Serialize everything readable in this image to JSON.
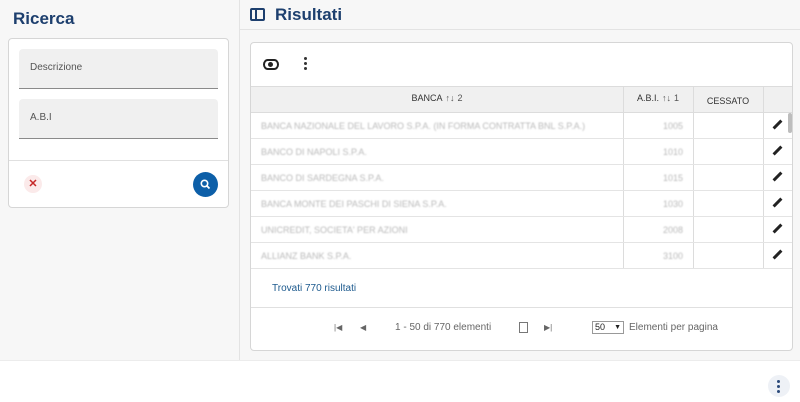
{
  "left_panel": {
    "title": "Ricerca",
    "fields": [
      {
        "placeholder": "Descrizione"
      },
      {
        "placeholder": "A.B.I"
      }
    ],
    "clear_icon": "close-icon",
    "search_icon": "search-icon"
  },
  "right_panel": {
    "title": "Risultati",
    "toolbar": {
      "view_icon": "eye-icon",
      "menu_icon": "more-vertical-icon"
    },
    "table": {
      "columns": [
        {
          "label": "BANCA",
          "sort": "2"
        },
        {
          "label": "A.B.I.",
          "sort": "1"
        },
        {
          "label": "CESSATO",
          "sort": ""
        }
      ],
      "rows": [
        {
          "banca": "BANCA NAZIONALE DEL LAVORO S.P.A. (IN FORMA CONTRATTA BNL S.P.A.)",
          "abi": "1005",
          "cessato": ""
        },
        {
          "banca": "BANCO DI NAPOLI S.P.A.",
          "abi": "1010",
          "cessato": ""
        },
        {
          "banca": "BANCO DI SARDEGNA S.P.A.",
          "abi": "1015",
          "cessato": ""
        },
        {
          "banca": "BANCA MONTE DEI PASCHI DI SIENA S.P.A.",
          "abi": "1030",
          "cessato": ""
        },
        {
          "banca": "UNICREDIT, SOCIETA' PER AZIONI",
          "abi": "2008",
          "cessato": ""
        },
        {
          "banca": "ALLIANZ BANK S.P.A.",
          "abi": "3100",
          "cessato": ""
        }
      ]
    },
    "results_text": "Trovati 770 risultati",
    "pagination": {
      "range_text": "1 - 50 di 770 elementi",
      "page_size": "50",
      "per_page_label": "Elementi per pagina",
      "first_icon": "first-page-icon",
      "prev_icon": "prev-page-icon",
      "next_icon": "next-page-icon"
    }
  },
  "fab": {
    "icon": "more-vertical-icon"
  }
}
